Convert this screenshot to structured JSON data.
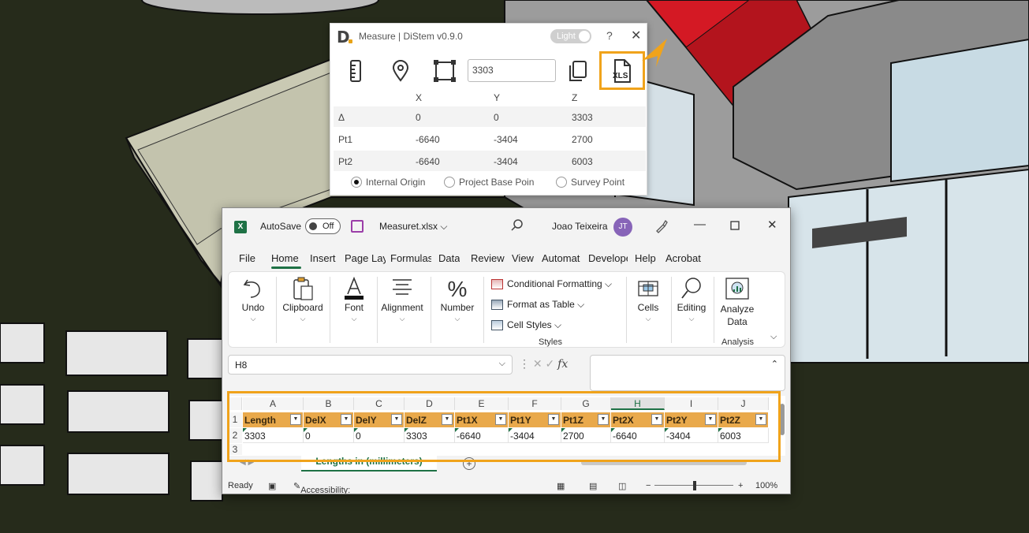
{
  "measure_panel": {
    "title": "Measure | DiStem v0.9.0",
    "theme_toggle": "Light",
    "help": "?",
    "close": "✕",
    "value": "3303",
    "export_label": "XLS",
    "columns": [
      "X",
      "Y",
      "Z"
    ],
    "rows": [
      {
        "label": "Δ",
        "x": "0",
        "y": "0",
        "z": "3303"
      },
      {
        "label": "Pt1",
        "x": "-6640",
        "y": "-3404",
        "z": "2700"
      },
      {
        "label": "Pt2",
        "x": "-6640",
        "y": "-3404",
        "z": "6003"
      }
    ],
    "origins": [
      {
        "label": "Internal Origin",
        "selected": true
      },
      {
        "label": "Project Base Poin",
        "selected": false
      },
      {
        "label": "Survey Point",
        "selected": false
      }
    ],
    "accent": "#f0a31b"
  },
  "excel": {
    "autosave": "AutoSave",
    "autosave_state": "Off",
    "filename": "Measuret.xlsx ⌵",
    "user": "Joao Teixeira",
    "initials": "JT",
    "tabs": [
      "File",
      "Home",
      "Insert",
      "Page Lay",
      "Formulas",
      "Data",
      "Review",
      "View",
      "Automat",
      "Develope",
      "Help",
      "Acrobat"
    ],
    "ribbon": {
      "undo": "Undo",
      "clipboard": "Clipboard",
      "font": "Font",
      "alignment": "Alignment",
      "number": "Number",
      "conditional": "Conditional Formatting ⌵",
      "format_table": "Format as Table ⌵",
      "cell_styles": "Cell Styles ⌵",
      "styles": "Styles",
      "cells": "Cells",
      "editing": "Editing",
      "analyze_line1": "Analyze",
      "analyze_line2": "Data",
      "analysis": "Analysis"
    },
    "name_box": "H8",
    "fx": "fx",
    "column_letters": [
      "A",
      "B",
      "C",
      "D",
      "E",
      "F",
      "G",
      "H",
      "I",
      "J"
    ],
    "row_numbers": [
      "1",
      "2",
      "3"
    ],
    "headers": [
      "Length",
      "DelX",
      "DelY",
      "DelZ",
      "Pt1X",
      "Pt1Y",
      "Pt1Z",
      "Pt2X",
      "Pt2Y",
      "Pt2Z"
    ],
    "values": [
      "3303",
      "0",
      "0",
      "3303",
      "-6640",
      "-3404",
      "2700",
      "-6640",
      "-3404",
      "6003"
    ],
    "sheet_tab": "Lengths in (millimeters)",
    "add_sheet": "+",
    "status_ready": "Ready",
    "accessibility": "Accessibility: Good to go",
    "zoom": "100%",
    "brand_color": "#1e7145",
    "header_fill": "#e9a94b"
  }
}
